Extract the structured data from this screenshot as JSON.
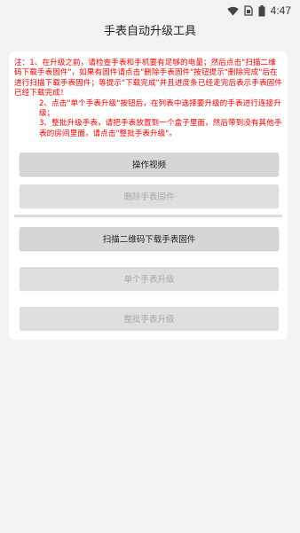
{
  "status_bar": {
    "time": "4:47",
    "icons": [
      "wifi-icon",
      "sim-icon",
      "battery-icon"
    ]
  },
  "app": {
    "title": "手表自动升级工具"
  },
  "notice": {
    "color": "#ff0000",
    "lines": [
      "注：1、在升级之前，请检查手表和手机要有足够的电量；然后点击\"扫描二维码下载手表固件\"，如果有固件请点击\"删除手表固件\"按钮提示\"删除完成\"后在进行扫描下载手表固件；等提示\"下载完成\"并且进度条已经走完后表示手表固件已经下载完成！",
      "2、点击\"单个手表升级\"按钮后，在列表中选择要升级的手表进行连接升级；",
      "3、整批升级手表，请把手表放置到一个盒子里面，然后带到没有其他手表的房间里面，请点击\"整批手表升级\"。"
    ]
  },
  "buttons": {
    "operation_video": "操作视频",
    "delete_firmware": "删除手表固件",
    "scan_download": "扫描二维码下载手表固件",
    "single_upgrade": "单个手表升级",
    "batch_upgrade": "整批手表升级"
  }
}
